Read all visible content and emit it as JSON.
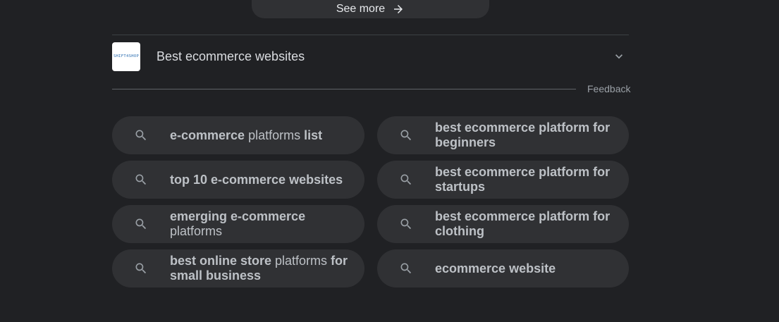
{
  "see_more": {
    "label": "See more"
  },
  "result": {
    "logo_text": "SHIFT4SHOP",
    "title": "Best ecommerce websites"
  },
  "feedback_label": "Feedback",
  "related_searches": [
    {
      "segments": [
        {
          "t": "e-commerce",
          "b": true
        },
        {
          "t": " platforms ",
          "b": false
        },
        {
          "t": "list",
          "b": true
        }
      ]
    },
    {
      "segments": [
        {
          "t": "best ecommerce platform for beginners",
          "b": true
        }
      ]
    },
    {
      "segments": [
        {
          "t": "top 10 e-commerce websites",
          "b": true
        }
      ]
    },
    {
      "segments": [
        {
          "t": "best ecommerce platform for startups",
          "b": true
        }
      ]
    },
    {
      "segments": [
        {
          "t": "emerging e-commerce",
          "b": true
        },
        {
          "t": " platforms",
          "b": false
        }
      ]
    },
    {
      "segments": [
        {
          "t": "best ecommerce platform for clothing",
          "b": true
        }
      ]
    },
    {
      "segments": [
        {
          "t": "best online store",
          "b": true
        },
        {
          "t": " platforms ",
          "b": false
        },
        {
          "t": "for small business",
          "b": true
        }
      ]
    },
    {
      "segments": [
        {
          "t": "ecommerce website",
          "b": true
        }
      ]
    }
  ],
  "icons": {
    "see_more": "arrow-right-icon",
    "result": "chevron-down-icon",
    "chip": "search-icon"
  },
  "colors": {
    "background": "#202124",
    "chip": "#303134",
    "text": "#bdc1c6"
  }
}
